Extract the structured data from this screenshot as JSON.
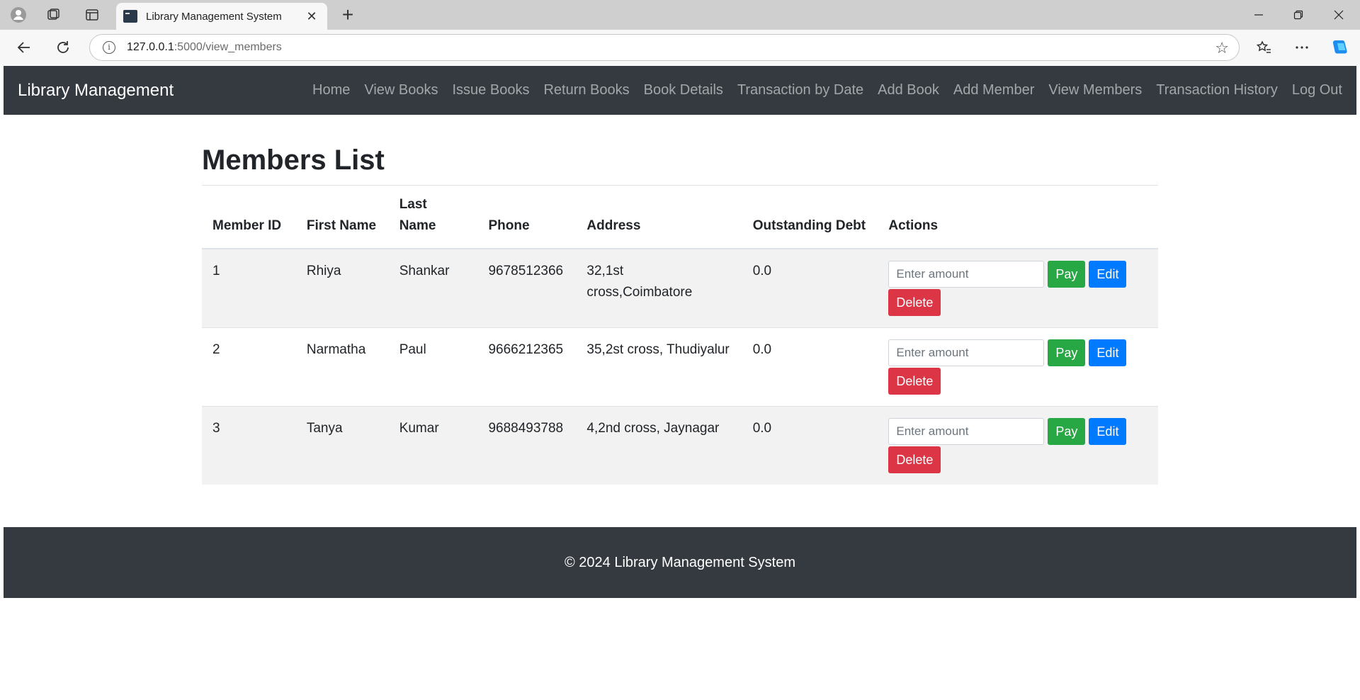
{
  "browser": {
    "tab_title": "Library Management System",
    "url_host": "127.0.0.1",
    "url_rest": ":5000/view_members"
  },
  "navbar": {
    "brand": "Library Management",
    "links": [
      "Home",
      "View Books",
      "Issue Books",
      "Return Books",
      "Book Details",
      "Transaction by Date",
      "Add Book",
      "Add Member",
      "View Members",
      "Transaction History",
      "Log Out"
    ]
  },
  "page": {
    "title": "Members List"
  },
  "table": {
    "headers": {
      "member_id": "Member ID",
      "first_name": "First Name",
      "last_name": "Last Name",
      "phone": "Phone",
      "address": "Address",
      "outstanding_debt": "Outstanding Debt",
      "actions": "Actions"
    },
    "rows": [
      {
        "member_id": "1",
        "first_name": "Rhiya",
        "last_name": "Shankar",
        "phone": "9678512366",
        "address": "32,1st cross,Coimbatore",
        "debt": "0.0"
      },
      {
        "member_id": "2",
        "first_name": "Narmatha",
        "last_name": "Paul",
        "phone": "9666212365",
        "address": "35,2st cross, Thudiyalur",
        "debt": "0.0"
      },
      {
        "member_id": "3",
        "first_name": "Tanya",
        "last_name": "Kumar",
        "phone": "9688493788",
        "address": "4,2nd cross, Jaynagar",
        "debt": "0.0"
      }
    ],
    "amount_placeholder": "Enter amount",
    "pay_label": "Pay",
    "edit_label": "Edit",
    "delete_label": "Delete"
  },
  "footer": {
    "text": "© 2024 Library Management System"
  },
  "colors": {
    "navbar_bg": "#343a40",
    "pay": "#28a745",
    "edit": "#007bff",
    "delete": "#dc3545"
  }
}
